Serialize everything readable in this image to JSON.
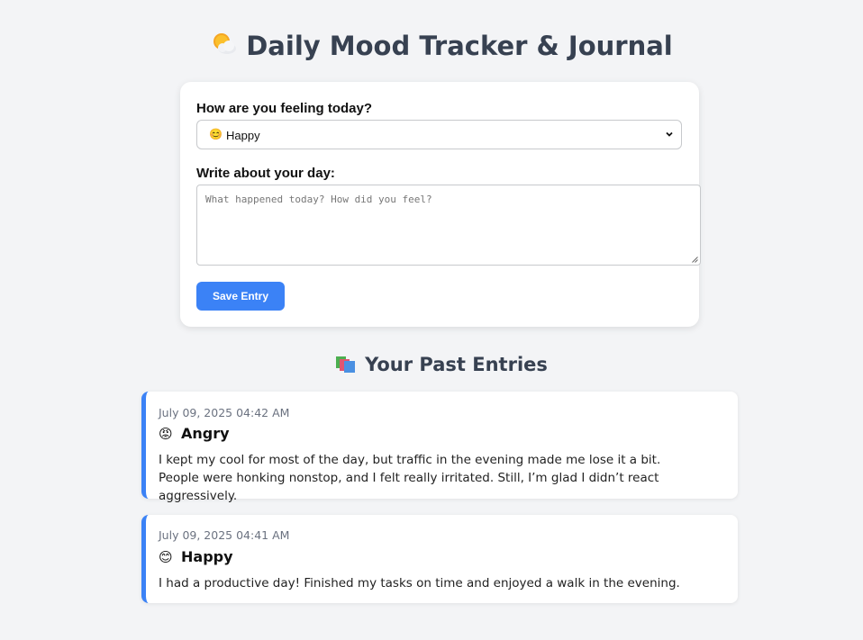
{
  "header": {
    "title": "Daily Mood Tracker & Journal",
    "title_icon": "sun-behind-cloud-icon"
  },
  "form": {
    "mood_label": "How are you feeling today?",
    "mood_selected_emoji": "😊",
    "mood_selected": "Happy",
    "journal_label": "Write about your day:",
    "journal_placeholder": "What happened today? How did you feel?",
    "journal_value": "",
    "save_label": "Save Entry",
    "accent_color": "#3b82f6"
  },
  "entries_section": {
    "title": "Your Past Entries",
    "title_icon": "books-icon"
  },
  "entries": [
    {
      "date": "July 09, 2025 04:42 AM",
      "mood_emoji": "😡",
      "mood": "Angry",
      "text": "I kept my cool for most of the day, but traffic in the evening made me lose it a bit.\nPeople were honking nonstop, and I felt really irritated. Still, I’m glad I didn’t react aggressively."
    },
    {
      "date": "July 09, 2025 04:41 AM",
      "mood_emoji": "😊",
      "mood": "Happy",
      "text": "I had a productive day! Finished my tasks on time and enjoyed a walk in the evening."
    }
  ]
}
